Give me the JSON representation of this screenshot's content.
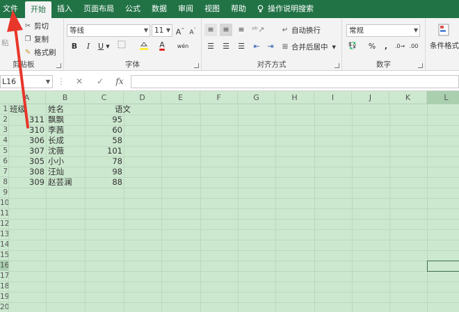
{
  "tabs": [
    "文件",
    "开始",
    "插入",
    "页面布局",
    "公式",
    "数据",
    "审阅",
    "视图",
    "帮助",
    "操作说明搜索"
  ],
  "ribbon": {
    "clipboard": {
      "cut": "剪切",
      "copy": "复制",
      "format_painter": "格式刷",
      "paste_partial": "粘",
      "label_partial": "剪贴板"
    },
    "font": {
      "font_name": "等线",
      "font_size": "11",
      "grow": "A",
      "shrink": "A",
      "bold": "B",
      "italic": "I",
      "underline": "U",
      "font_color": "A",
      "wen": "wén",
      "label": "字体"
    },
    "alignment": {
      "wrap_text": "自动换行",
      "merge_center": "合并后居中",
      "label": "对齐方式"
    },
    "number": {
      "format": "常规",
      "percent": "%",
      "comma": ",",
      "label": "数字"
    },
    "styles": {
      "conditional_partial": "条件格式"
    }
  },
  "formula_bar": {
    "name_box": "L16",
    "cancel": "✕",
    "enter": "✓",
    "fx": "fx",
    "value": ""
  },
  "columns": [
    "A",
    "B",
    "C",
    "D",
    "E",
    "F",
    "G",
    "H",
    "I",
    "J",
    "K",
    "L"
  ],
  "rows": [
    "1",
    "2",
    "3",
    "4",
    "5",
    "6",
    "7",
    "8",
    "9",
    "10",
    "11",
    "12",
    "13",
    "14",
    "15",
    "16",
    "17",
    "18",
    "19",
    "20"
  ],
  "sheet": {
    "headers": {
      "class": "班级",
      "name": "姓名",
      "chinese": "语文"
    },
    "data": [
      {
        "class": "311",
        "name": "飘飘",
        "score": "95"
      },
      {
        "class": "310",
        "name": "李茜",
        "score": "60"
      },
      {
        "class": "306",
        "name": "长成",
        "score": "58"
      },
      {
        "class": "307",
        "name": "沈薇",
        "score": "101"
      },
      {
        "class": "305",
        "name": "小小",
        "score": "78"
      },
      {
        "class": "308",
        "name": "汪灿",
        "score": "98"
      },
      {
        "class": "309",
        "name": "赵芸澜",
        "score": "88"
      }
    ]
  },
  "colors": {
    "accent": "#217346",
    "sheet_bg": "#cce8cf",
    "arrow": "#e8362b"
  }
}
